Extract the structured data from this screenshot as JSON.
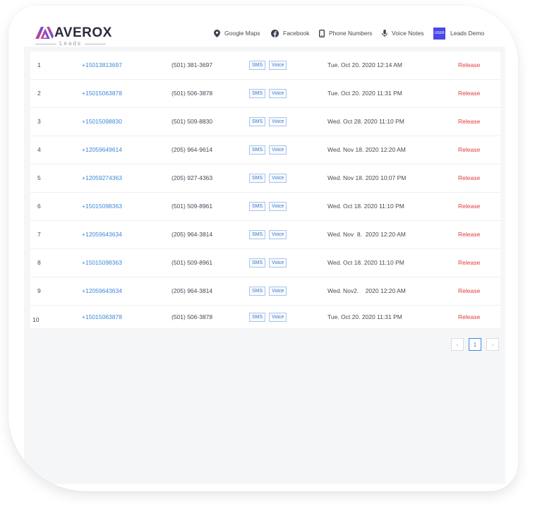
{
  "logo": {
    "name": "AVEROX",
    "sub": "Leads"
  },
  "nav": [
    {
      "label": "Google Maps",
      "icon": "map-pin-icon"
    },
    {
      "label": "Facebook",
      "icon": "facebook-icon"
    },
    {
      "label": "Phone Numbers",
      "icon": "phone-icon"
    },
    {
      "label": "Voice Notes",
      "icon": "microphone-icon"
    }
  ],
  "user": {
    "badge": "USER",
    "name": "Leads Demo"
  },
  "table": {
    "tag_sms": "SMS",
    "tag_voice": "Voice",
    "rows": [
      {
        "idx": "1",
        "number": "+15013813697",
        "formatted": "(501) 381-3697",
        "date": "Tue. Oct 20. 2020 12:14 AM",
        "action": "Release"
      },
      {
        "idx": "2",
        "number": "+15015063878",
        "formatted": "(501) 506-3878",
        "date": "Tue. Oct 20. 2020 11:31 PM",
        "action": "Release"
      },
      {
        "idx": "3",
        "number": "+15015098830",
        "formatted": "(501) 509-8830",
        "date": "Wed. Oct 28. 2020 11:10 PM",
        "action": "Release"
      },
      {
        "idx": "4",
        "number": "+12059649614",
        "formatted": "(205) 964-9614",
        "date": "Wed. Nov 18. 2020 12:20 AM",
        "action": "Release"
      },
      {
        "idx": "5",
        "number": "+12059274363",
        "formatted": "(205) 927-4363",
        "date": "Wed. Nov 18. 2020 10:07 PM",
        "action": "Release"
      },
      {
        "idx": "6",
        "number": "+15015098363",
        "formatted": "(501) 509-8961",
        "date": "Wed. Oct 18. 2020 11:10 PM",
        "action": "Release"
      },
      {
        "idx": "7",
        "number": "+12059643634",
        "formatted": "(205) 964-3814",
        "date": "Wed. Nov  8.  2020 12:20 AM",
        "action": "Release"
      },
      {
        "idx": "8",
        "number": "+15015098363",
        "formatted": "(501) 509-8961",
        "date": "Wed. Oct 18. 2020 11:10 PM",
        "action": "Release"
      },
      {
        "idx": "9",
        "number": "+12059643634",
        "formatted": "(205) 964-3814",
        "date": "Wed. Nov2.    2020 12:20 AM",
        "action": "Release"
      },
      {
        "idx": "10",
        "number": "+15015063878",
        "formatted": "(501) 506-3878",
        "date": "Tue. Oct 20. 2020 11:31 PM",
        "action": "Release"
      }
    ]
  },
  "pagination": {
    "prev": "‹",
    "current": "1",
    "next": "›"
  },
  "colors": {
    "accent": "#3b8ad9",
    "danger": "#e23b3b",
    "user_badge": "#4a47e6"
  }
}
